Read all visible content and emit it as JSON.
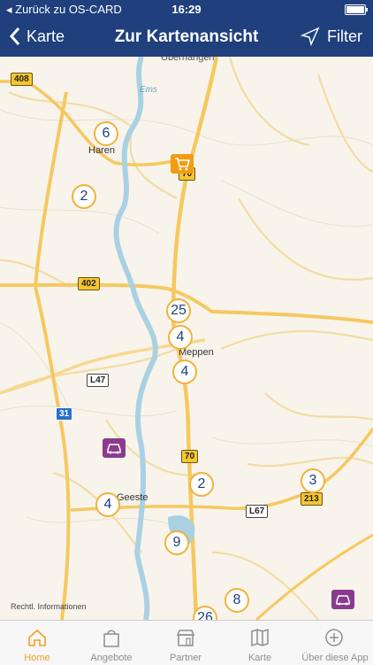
{
  "status_bar": {
    "back_label": "Zurück zu OS-CARD",
    "time": "16:29"
  },
  "nav": {
    "back_label": "Karte",
    "title": "Zur Kartenansicht",
    "filter_label": "Filter"
  },
  "map": {
    "clusters": [
      "6",
      "2",
      "25",
      "4",
      "4",
      "2",
      "3",
      "4",
      "9",
      "8",
      "26"
    ],
    "places": [
      "Haren",
      "Meppen",
      "Geeste",
      "Ems"
    ],
    "road_signs": [
      "408",
      "70",
      "402",
      "L47",
      "31",
      "70",
      "L67",
      "213"
    ],
    "legal_link": "Rechtl. Informationen",
    "marker_icons": [
      "shopping-cart-icon",
      "car-icon",
      "car-icon"
    ],
    "colors": {
      "cluster_ring": "#f2b23a",
      "cluster_text": "#1f3f7d",
      "shop_marker": "#f39c12",
      "car_marker": "#8a3b8f"
    }
  },
  "tab_bar": {
    "tabs": [
      "Home",
      "Angebote",
      "Partner",
      "Karte",
      "Über diese App"
    ],
    "active": "Home"
  },
  "theme": {
    "header_bg": "#1f3f7d",
    "accent": "#f0a122"
  }
}
